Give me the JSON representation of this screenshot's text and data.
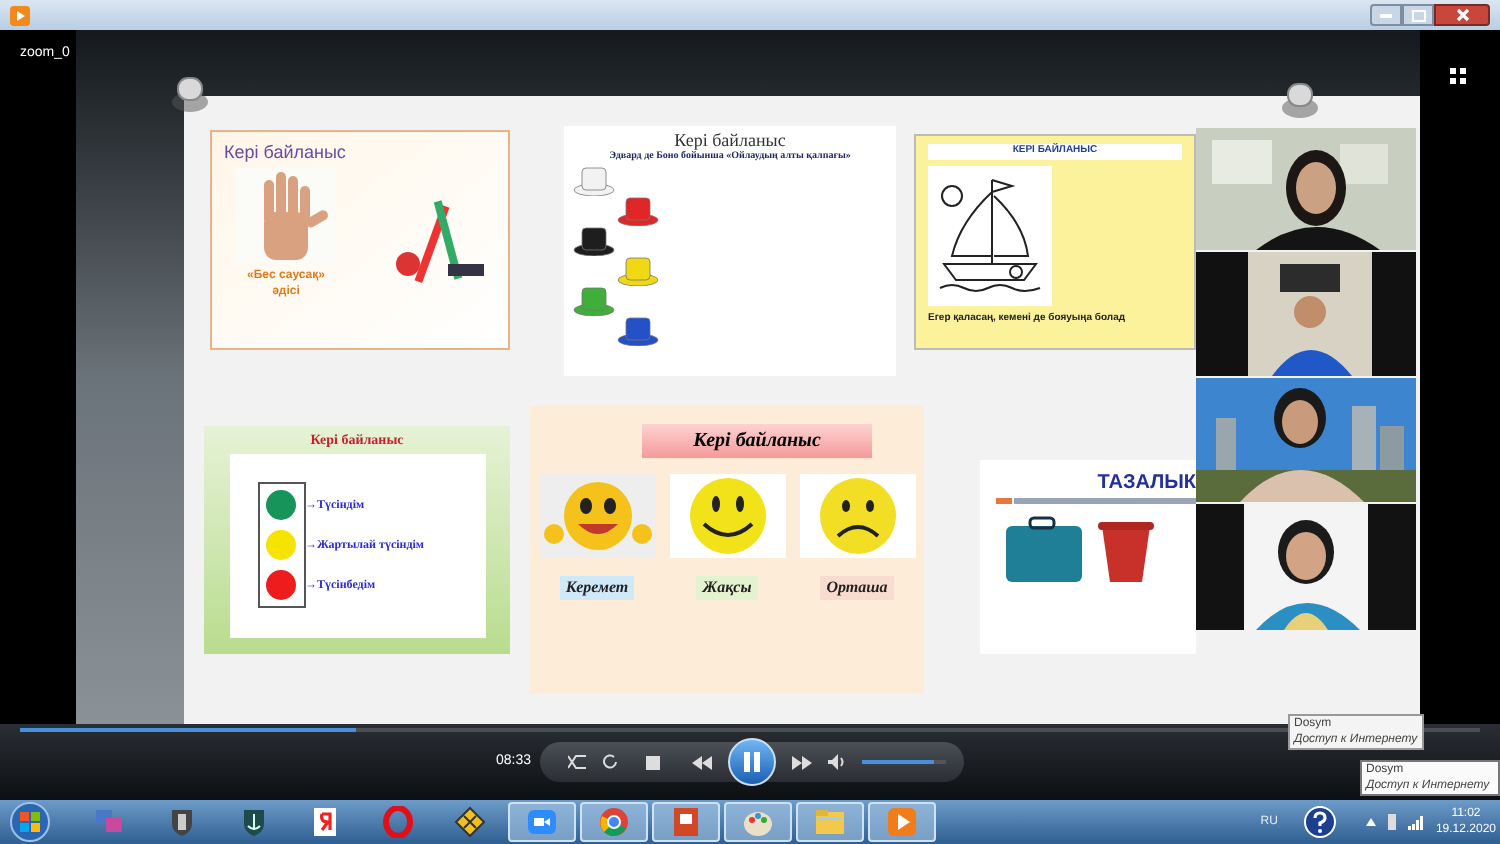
{
  "video": {
    "label": "zoom_0"
  },
  "slides": [
    {
      "kind": "hand",
      "title": "Кері байланыс",
      "caption": "«Бес саусақ» әдісі"
    },
    {
      "kind": "hats",
      "title": "Кері байланыс",
      "subtitle": "Эдвард де Боно бойынша «Ойлаудың алты қалпағы»",
      "hats": [
        {
          "color": "#f2f2f2"
        },
        {
          "color": "#e02626"
        },
        {
          "color": "#1e1e1e"
        },
        {
          "color": "#f0d814"
        },
        {
          "color": "#3fae3a"
        },
        {
          "color": "#2450c8"
        }
      ]
    },
    {
      "kind": "boat",
      "title": "КЕРІ БАЙЛАНЫС",
      "caption": "Егер қаласаң, кемені де бояуыңа болад"
    },
    {
      "kind": "traffic",
      "title": "Кері байланыс",
      "lights": [
        {
          "label": "→Түсіндім",
          "color": "#17945a"
        },
        {
          "label": "→Жартылай түсіндім",
          "color": "#f5e400"
        },
        {
          "label": "→Түсінбедім",
          "color": "#ee1c1c"
        }
      ]
    },
    {
      "kind": "smileys",
      "title": "Кері байланыс",
      "ratings": [
        {
          "label": "Керемет",
          "color": "#cfe9f8"
        },
        {
          "label": "Жақсы",
          "color": "#e4f2cf"
        },
        {
          "label": "Орташа",
          "color": "#f8dccf"
        }
      ]
    },
    {
      "kind": "cleanliness",
      "title": "ТАЗАЛЫК"
    }
  ],
  "player": {
    "progress": {
      "level": 0.23
    },
    "time": "08:33",
    "volume": {
      "level": 0.85
    }
  },
  "tooltips": [
    {
      "title": "Dosym",
      "text": "Доступ к Интернету"
    },
    {
      "title": "Dosym",
      "text": "Доступ к Интернету"
    }
  ],
  "taskbar": {
    "apps": [
      {
        "running": false
      },
      {
        "running": false
      },
      {
        "running": false
      },
      {
        "running": false
      },
      {
        "running": false
      },
      {
        "running": false
      },
      {
        "running": true
      },
      {
        "running": true
      },
      {
        "running": true
      },
      {
        "running": true
      },
      {
        "running": true
      },
      {
        "running": true
      }
    ],
    "language": "RU",
    "time": "11:02",
    "date": "19.12.2020"
  }
}
